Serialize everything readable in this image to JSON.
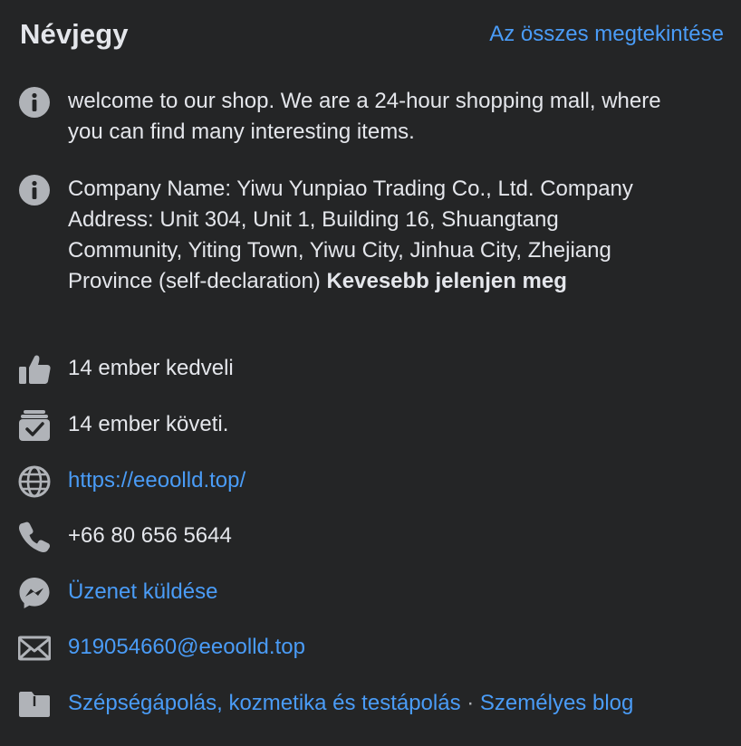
{
  "header": {
    "title": "Névjegy",
    "see_all": "Az összes megtekintése"
  },
  "about": {
    "intro": "welcome to our shop. We are a 24-hour shopping mall, where you can find many interesting items.",
    "details": "Company Name: Yiwu Yunpiao Trading Co., Ltd. Company Address: Unit 304, Unit 1, Building 16, Shuangtang Community, Yiting Town, Yiwu City, Jinhua City, Zhejiang Province (self-declaration)",
    "show_less": "Kevesebb jelenjen meg",
    "likes": "14 ember kedveli",
    "followers": "14 ember követi.",
    "website": "https://eeoolld.top/",
    "phone": "+66 80 656 5644",
    "message": "Üzenet küldése",
    "email": "919054660@eeoolld.top",
    "category_1": "Szépségápolás, kozmetika és testápolás",
    "category_separator": " · ",
    "category_2": "Személyes blog"
  },
  "icons": {
    "info": "info-icon",
    "like": "thumbs-up-icon",
    "follow": "follow-check-icon",
    "website": "globe-icon",
    "phone": "phone-icon",
    "messenger": "messenger-icon",
    "email": "envelope-icon",
    "category": "folder-icon"
  },
  "colors": {
    "background": "#242526",
    "text": "#e4e6eb",
    "icon": "#b0b3b8",
    "link": "#4a9cf7"
  }
}
